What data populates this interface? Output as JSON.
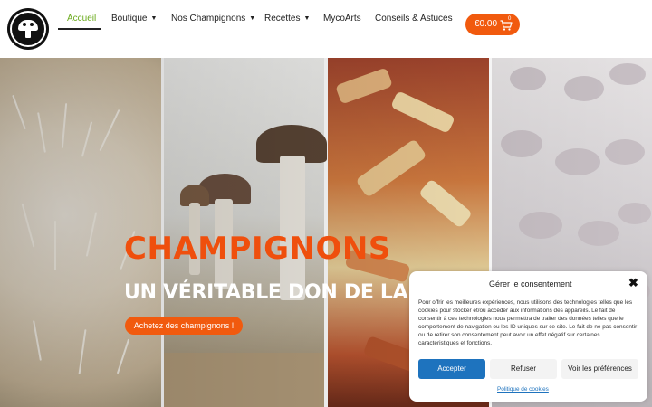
{
  "brand": {
    "logo_text": "CHAMPIGNONS"
  },
  "nav": {
    "items": [
      {
        "label": "Accueil",
        "active": true,
        "dropdown": false
      },
      {
        "label": "Boutique",
        "active": false,
        "dropdown": true
      },
      {
        "label": "Nos Champignons",
        "active": false,
        "dropdown": true
      },
      {
        "label": "Recettes",
        "active": false,
        "dropdown": true
      },
      {
        "label": "MycoArts",
        "active": false,
        "dropdown": false
      },
      {
        "label": "Conseils & Astuces",
        "active": false,
        "dropdown": false
      }
    ],
    "dropdown_glyph": "▼"
  },
  "cart": {
    "price": "€0.00",
    "count": "0",
    "icon": "cart-icon"
  },
  "hero": {
    "title": "CHAMPIGNONS",
    "subtitle": "UN VÉRITABLE DON DE LA N",
    "cta_label": "Achetez des champignons !"
  },
  "consent": {
    "title": "Gérer le consentement",
    "close_glyph": "✖",
    "body": "Pour offrir les meilleures expériences, nous utilisons des technologies telles que les cookies pour stocker et/ou accéder aux informations des appareils. Le fait de consentir à ces technologies nous permettra de traiter des données telles que le comportement de navigation ou les ID uniques sur ce site. Le fait de ne pas consentir ou de retirer son consentement peut avoir un effet négatif sur certaines caractéristiques et fonctions.",
    "accept_label": "Accepter",
    "refuse_label": "Refuser",
    "prefs_label": "Voir les préférences",
    "policy_label": "Politique de cookies"
  },
  "colors": {
    "accent": "#f15a0e",
    "active_nav": "#6aaa1c",
    "primary_button": "#1e73be"
  }
}
